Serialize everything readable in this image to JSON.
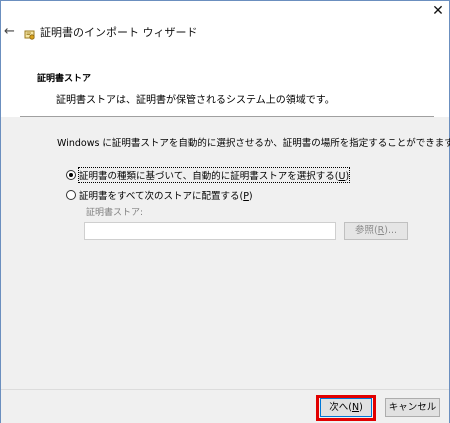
{
  "window": {
    "title": "証明書のインポート ウィザード",
    "close_glyph": "✕",
    "back_glyph": "←",
    "icons": {
      "back": "back-arrow-icon",
      "title": "certificate-icon",
      "close": "close-icon"
    }
  },
  "header": {
    "title": "証明書ストア",
    "description": "証明書ストアは、証明書が保管されるシステム上の領域です。"
  },
  "main": {
    "instruction": "Windows に証明書ストアを自動的に選択させるか、証明書の場所を指定することができます。",
    "options": [
      {
        "label": "証明書の種類に基づいて、自動的に証明書ストアを選択する",
        "accesskey": "U",
        "selected": true
      },
      {
        "label": "証明書をすべて次のストアに配置する",
        "accesskey": "P",
        "selected": false
      }
    ],
    "store_label": "証明書ストア:",
    "store_value": "",
    "browse_label": "参照",
    "browse_accesskey": "R",
    "browse_suffix": "..."
  },
  "footer": {
    "next_label": "次へ",
    "next_accesskey": "N",
    "cancel_label": "キャンセル"
  },
  "colors": {
    "highlight": "#e10000",
    "focus_border": "#0078d7"
  }
}
